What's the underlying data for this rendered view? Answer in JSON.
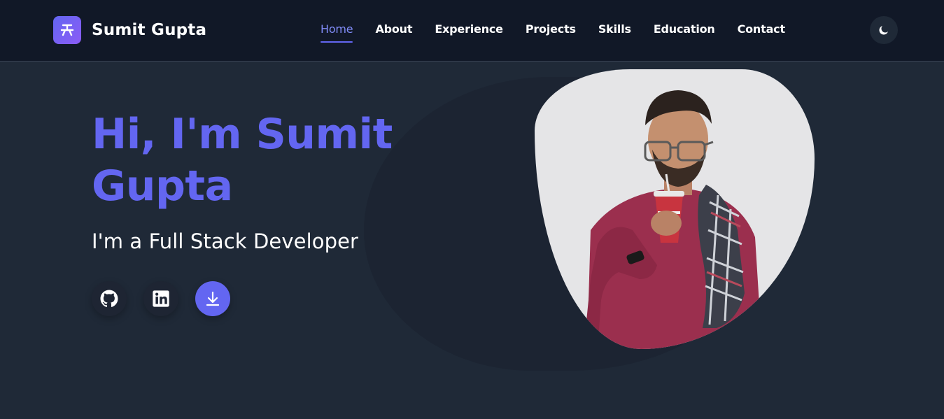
{
  "brand": {
    "name": "Sumit Gupta",
    "logo_icon": "code-branch-icon"
  },
  "nav": {
    "items": [
      {
        "label": "Home",
        "active": true
      },
      {
        "label": "About",
        "active": false
      },
      {
        "label": "Experience",
        "active": false
      },
      {
        "label": "Projects",
        "active": false
      },
      {
        "label": "Skills",
        "active": false
      },
      {
        "label": "Education",
        "active": false
      },
      {
        "label": "Contact",
        "active": false
      }
    ],
    "theme_toggle_icon": "moon-icon"
  },
  "hero": {
    "title": "Hi, I'm Sumit Gupta",
    "subtitle": "I'm a Full Stack Developer",
    "social": [
      {
        "icon": "github-icon"
      },
      {
        "icon": "linkedin-icon"
      },
      {
        "icon": "download-icon"
      }
    ],
    "photo_icon": "profile-photo"
  },
  "colors": {
    "accent": "#6366f1",
    "nav_bg": "#111827",
    "page_bg": "#1f2937",
    "text": "#ffffff"
  }
}
